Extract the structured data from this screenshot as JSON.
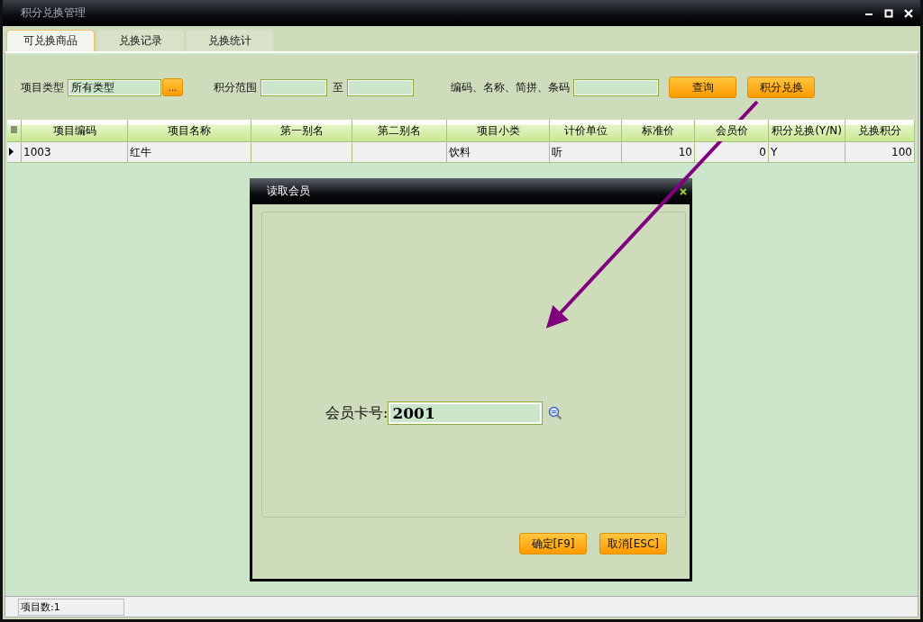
{
  "window": {
    "title": "积分兑换管理"
  },
  "tabs": [
    {
      "label": "可兑换商品",
      "selected": true
    },
    {
      "label": "兑换记录",
      "selected": false
    },
    {
      "label": "兑换统计",
      "selected": false
    }
  ],
  "filters": {
    "type_label": "项目类型",
    "type_value": "所有类型",
    "browse_button": "...",
    "range_label": "积分范围",
    "range_to": "至",
    "search_label": "编码、名称、简拼、条码",
    "query_button": "查询",
    "redeem_button": "积分兑换"
  },
  "table": {
    "columns": [
      "项目编码",
      "项目名称",
      "第一别名",
      "第二别名",
      "项目小类",
      "计价单位",
      "标准价",
      "会员价",
      "积分兑换(Y/N)",
      "兑换积分"
    ],
    "rows": [
      {
        "selected": true,
        "cells": [
          "1003",
          "红牛",
          "",
          "",
          "饮料",
          "听",
          "10",
          "0",
          "Y",
          "100"
        ]
      }
    ]
  },
  "dialog": {
    "title": "读取会员",
    "field_label": "会员卡号:",
    "field_value": "2001",
    "buttons": [
      "确定[F9]",
      "取消[ESC]"
    ]
  },
  "status_bar": {
    "text": "项目数:1"
  }
}
